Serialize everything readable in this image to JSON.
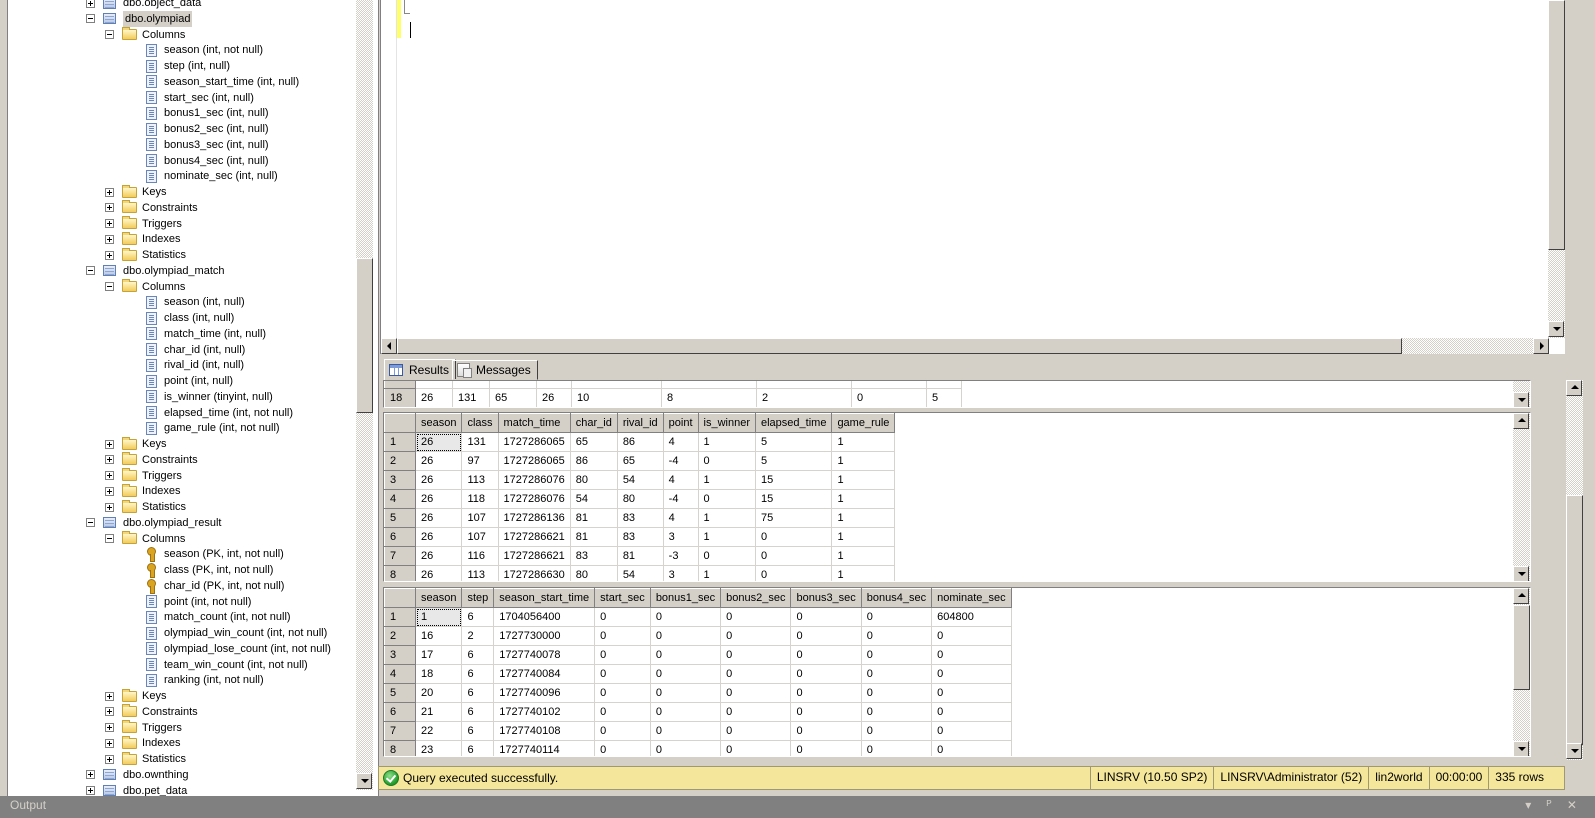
{
  "explorer": {
    "rows": [
      {
        "level": 0,
        "expander": "plus",
        "icon": "table",
        "label": "dbo.object_data"
      },
      {
        "level": 0,
        "expander": "minus",
        "icon": "table",
        "label": "dbo.olympiad",
        "selected": true
      },
      {
        "level": 1,
        "expander": "minus",
        "icon": "folder",
        "label": "Columns"
      },
      {
        "level": 2,
        "icon": "column",
        "label": "season (int, not null)"
      },
      {
        "level": 2,
        "icon": "column",
        "label": "step (int, null)"
      },
      {
        "level": 2,
        "icon": "column",
        "label": "season_start_time (int, null)"
      },
      {
        "level": 2,
        "icon": "column",
        "label": "start_sec (int, null)"
      },
      {
        "level": 2,
        "icon": "column",
        "label": "bonus1_sec (int, null)"
      },
      {
        "level": 2,
        "icon": "column",
        "label": "bonus2_sec (int, null)"
      },
      {
        "level": 2,
        "icon": "column",
        "label": "bonus3_sec (int, null)"
      },
      {
        "level": 2,
        "icon": "column",
        "label": "bonus4_sec (int, null)"
      },
      {
        "level": 2,
        "icon": "column",
        "label": "nominate_sec (int, null)"
      },
      {
        "level": 1,
        "expander": "plus",
        "icon": "folder",
        "label": "Keys"
      },
      {
        "level": 1,
        "expander": "plus",
        "icon": "folder",
        "label": "Constraints"
      },
      {
        "level": 1,
        "expander": "plus",
        "icon": "folder",
        "label": "Triggers"
      },
      {
        "level": 1,
        "expander": "plus",
        "icon": "folder",
        "label": "Indexes"
      },
      {
        "level": 1,
        "expander": "plus",
        "icon": "folder",
        "label": "Statistics"
      },
      {
        "level": 0,
        "expander": "minus",
        "icon": "table",
        "label": "dbo.olympiad_match"
      },
      {
        "level": 1,
        "expander": "minus",
        "icon": "folder",
        "label": "Columns"
      },
      {
        "level": 2,
        "icon": "column",
        "label": "season (int, null)"
      },
      {
        "level": 2,
        "icon": "column",
        "label": "class (int, null)"
      },
      {
        "level": 2,
        "icon": "column",
        "label": "match_time (int, null)"
      },
      {
        "level": 2,
        "icon": "column",
        "label": "char_id (int, null)"
      },
      {
        "level": 2,
        "icon": "column",
        "label": "rival_id (int, null)"
      },
      {
        "level": 2,
        "icon": "column",
        "label": "point (int, null)"
      },
      {
        "level": 2,
        "icon": "column",
        "label": "is_winner (tinyint, null)"
      },
      {
        "level": 2,
        "icon": "column",
        "label": "elapsed_time (int, not null)"
      },
      {
        "level": 2,
        "icon": "column",
        "label": "game_rule (int, not null)"
      },
      {
        "level": 1,
        "expander": "plus",
        "icon": "folder",
        "label": "Keys"
      },
      {
        "level": 1,
        "expander": "plus",
        "icon": "folder",
        "label": "Constraints"
      },
      {
        "level": 1,
        "expander": "plus",
        "icon": "folder",
        "label": "Triggers"
      },
      {
        "level": 1,
        "expander": "plus",
        "icon": "folder",
        "label": "Indexes"
      },
      {
        "level": 1,
        "expander": "plus",
        "icon": "folder",
        "label": "Statistics"
      },
      {
        "level": 0,
        "expander": "minus",
        "icon": "table",
        "label": "dbo.olympiad_result"
      },
      {
        "level": 1,
        "expander": "minus",
        "icon": "folder",
        "label": "Columns"
      },
      {
        "level": 2,
        "icon": "key",
        "label": "season (PK, int, not null)"
      },
      {
        "level": 2,
        "icon": "key",
        "label": "class (PK, int, not null)"
      },
      {
        "level": 2,
        "icon": "key",
        "label": "char_id (PK, int, not null)"
      },
      {
        "level": 2,
        "icon": "column",
        "label": "point (int, not null)"
      },
      {
        "level": 2,
        "icon": "column",
        "label": "match_count (int, not null)"
      },
      {
        "level": 2,
        "icon": "column",
        "label": "olympiad_win_count (int, not null)"
      },
      {
        "level": 2,
        "icon": "column",
        "label": "olympiad_lose_count (int, not null)"
      },
      {
        "level": 2,
        "icon": "column",
        "label": "team_win_count (int, not null)"
      },
      {
        "level": 2,
        "icon": "column",
        "label": "ranking (int, not null)"
      },
      {
        "level": 1,
        "expander": "plus",
        "icon": "folder",
        "label": "Keys"
      },
      {
        "level": 1,
        "expander": "plus",
        "icon": "folder",
        "label": "Constraints"
      },
      {
        "level": 1,
        "expander": "plus",
        "icon": "folder",
        "label": "Triggers"
      },
      {
        "level": 1,
        "expander": "plus",
        "icon": "folder",
        "label": "Indexes"
      },
      {
        "level": 1,
        "expander": "plus",
        "icon": "folder",
        "label": "Statistics"
      },
      {
        "level": 0,
        "expander": "plus",
        "icon": "table",
        "label": "dbo.ownthing"
      },
      {
        "level": 0,
        "expander": "plus",
        "icon": "table",
        "label": "dbo.pet_data"
      }
    ]
  },
  "results": {
    "tabs": [
      {
        "label": "Results",
        "icon": "grid-icon",
        "active": true
      },
      {
        "label": "Messages",
        "icon": "messages-icon",
        "active": false
      }
    ],
    "grid1": {
      "partial_row": {
        "rownum": "18",
        "cells": [
          "26",
          "131",
          "65",
          "26",
          "10",
          "8",
          "2",
          "0",
          "5"
        ]
      }
    },
    "grid2": {
      "columns": [
        "season",
        "class",
        "match_time",
        "char_id",
        "rival_id",
        "point",
        "is_winner",
        "elapsed_time",
        "game_rule"
      ],
      "rows": [
        [
          "26",
          "131",
          "1727286065",
          "65",
          "86",
          "4",
          "1",
          "5",
          "1"
        ],
        [
          "26",
          "97",
          "1727286065",
          "86",
          "65",
          "-4",
          "0",
          "5",
          "1"
        ],
        [
          "26",
          "113",
          "1727286076",
          "80",
          "54",
          "4",
          "1",
          "15",
          "1"
        ],
        [
          "26",
          "118",
          "1727286076",
          "54",
          "80",
          "-4",
          "0",
          "15",
          "1"
        ],
        [
          "26",
          "107",
          "1727286136",
          "81",
          "83",
          "4",
          "1",
          "75",
          "1"
        ],
        [
          "26",
          "107",
          "1727286621",
          "81",
          "83",
          "3",
          "1",
          "0",
          "1"
        ],
        [
          "26",
          "116",
          "1727286621",
          "83",
          "81",
          "-3",
          "0",
          "0",
          "1"
        ],
        [
          "26",
          "113",
          "1727286630",
          "80",
          "54",
          "3",
          "1",
          "0",
          "1"
        ]
      ]
    },
    "grid3": {
      "columns": [
        "season",
        "step",
        "season_start_time",
        "start_sec",
        "bonus1_sec",
        "bonus2_sec",
        "bonus3_sec",
        "bonus4_sec",
        "nominate_sec"
      ],
      "rows": [
        [
          "1",
          "6",
          "1704056400",
          "0",
          "0",
          "0",
          "0",
          "0",
          "604800"
        ],
        [
          "16",
          "2",
          "1727730000",
          "0",
          "0",
          "0",
          "0",
          "0",
          "0"
        ],
        [
          "17",
          "6",
          "1727740078",
          "0",
          "0",
          "0",
          "0",
          "0",
          "0"
        ],
        [
          "18",
          "6",
          "1727740084",
          "0",
          "0",
          "0",
          "0",
          "0",
          "0"
        ],
        [
          "20",
          "6",
          "1727740096",
          "0",
          "0",
          "0",
          "0",
          "0",
          "0"
        ],
        [
          "21",
          "6",
          "1727740102",
          "0",
          "0",
          "0",
          "0",
          "0",
          "0"
        ],
        [
          "22",
          "6",
          "1727740108",
          "0",
          "0",
          "0",
          "0",
          "0",
          "0"
        ],
        [
          "23",
          "6",
          "1727740114",
          "0",
          "0",
          "0",
          "0",
          "0",
          "0"
        ]
      ]
    }
  },
  "status": {
    "message": "Query executed successfully.",
    "server": "LINSRV (10.50 SP2)",
    "user": "LINSRV\\Administrator (52)",
    "database": "lin2world",
    "elapsed": "00:00:00",
    "rows": "335 rows",
    "color": "#f4e69a"
  },
  "output_panel": {
    "title": "Output",
    "controls": "▾ ᴾ ✕"
  }
}
